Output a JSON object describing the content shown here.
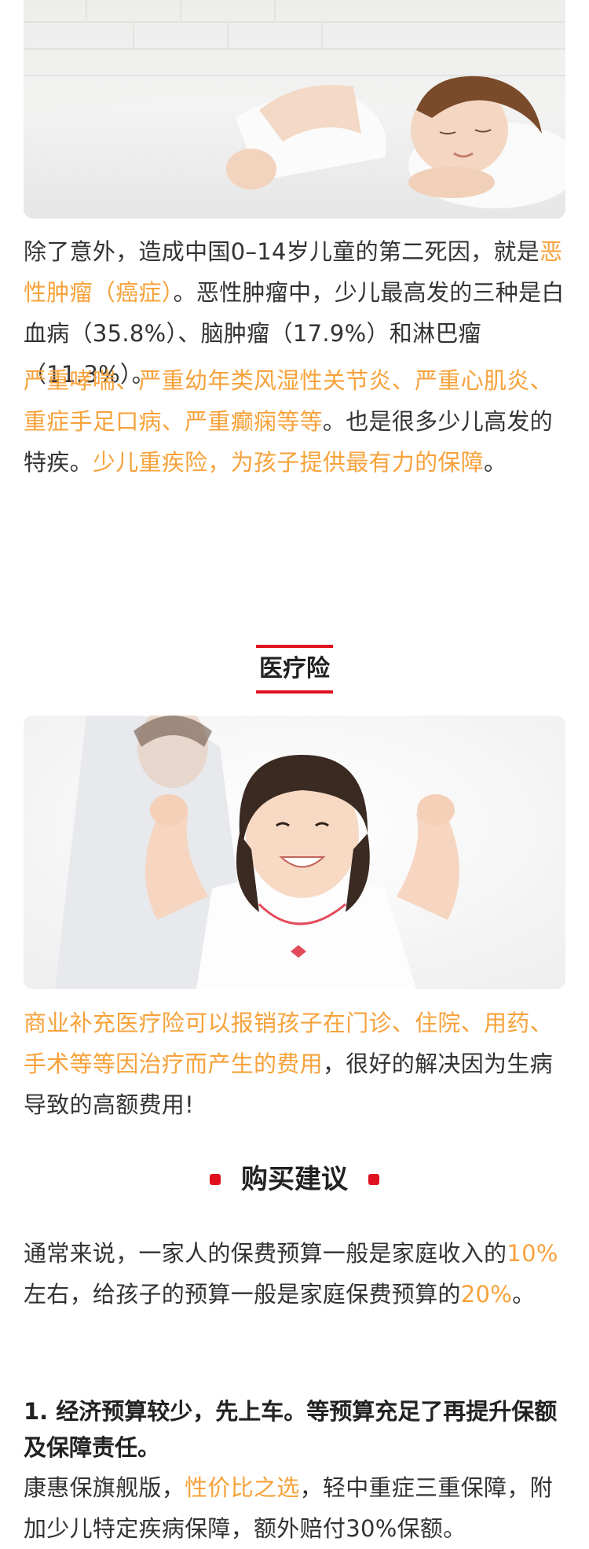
{
  "colors": {
    "accent_orange": "#f7a23b",
    "accent_red": "#e0101e",
    "text": "#333333"
  },
  "intro": {
    "p1_a": "除了意外，造成中国0–14岁儿童的第二死因，就是",
    "p1_b": "恶性肿瘤（癌症）",
    "p1_c": "。恶性肿瘤中，少儿最高发的三种是白血病（35.8%）、脑肿瘤（17.9%）和淋巴瘤（11.3%）。",
    "p2_a": "严重哮喘、严重幼年类风湿性关节炎、严重心肌炎、重症手足口病、严重癫痫等等",
    "p2_b": "。也是很多少儿高发的特疾。",
    "p2_c": "少儿重疾险，为孩子提供最有力的保障",
    "p2_d": "。"
  },
  "medical": {
    "title": "医疗险",
    "p_a": "商业补充医疗险可以报销孩子在门诊、住院、用药、手术等等因治疗而产生的费用",
    "p_b": "，很好的解决因为生病导致的高额费用!"
  },
  "advice": {
    "title": "购买建议",
    "p_a": "通常来说，一家人的保费预算一般是家庭收入的",
    "p_b": "10%",
    "p_c": "左右，给孩子的预算一般是家庭保费预算的",
    "p_d": "20%",
    "p_e": "。",
    "h1": "1. 经济预算较少，先上车。等预算充足了再提升保额及保障责任。",
    "p2_a": "康惠保旗舰版，",
    "p2_b": "性价比之选",
    "p2_c": "，轻中重症三重保障，附加少儿特定疾病保障，额外赔付30%保额。"
  }
}
